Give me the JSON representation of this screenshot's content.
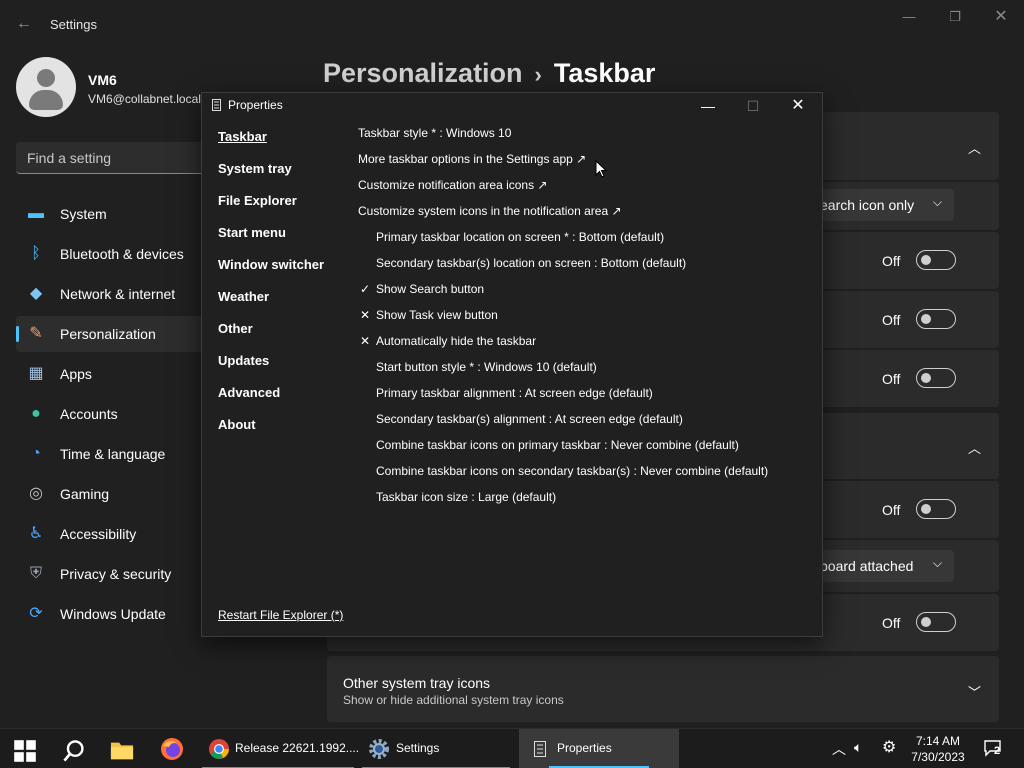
{
  "settings": {
    "window_title": "Settings",
    "profile": {
      "name": "VM6",
      "email": "VM6@collabnet.local"
    },
    "search_placeholder": "Find a setting",
    "nav": [
      {
        "label": "System",
        "icon": "system-icon"
      },
      {
        "label": "Bluetooth & devices",
        "icon": "bluetooth-icon"
      },
      {
        "label": "Network & internet",
        "icon": "network-icon"
      },
      {
        "label": "Personalization",
        "icon": "brush-icon",
        "active": true
      },
      {
        "label": "Apps",
        "icon": "apps-icon"
      },
      {
        "label": "Accounts",
        "icon": "accounts-icon"
      },
      {
        "label": "Time & language",
        "icon": "clock-globe-icon"
      },
      {
        "label": "Gaming",
        "icon": "gamepad-icon"
      },
      {
        "label": "Accessibility",
        "icon": "accessibility-icon"
      },
      {
        "label": "Privacy & security",
        "icon": "shield-icon"
      },
      {
        "label": "Windows Update",
        "icon": "update-icon"
      }
    ],
    "breadcrumb": {
      "parent": "Personalization",
      "separator": "›",
      "current": "Taskbar"
    },
    "search_dropdown_value": "earch icon only",
    "keyboard_dropdown_value": "board attached",
    "toggle_state": "Off",
    "other_tray": {
      "title": "Other system tray icons",
      "subtitle": "Show or hide additional system tray icons"
    }
  },
  "dialog": {
    "title": "Properties",
    "nav": [
      "Taskbar",
      "System tray",
      "File Explorer",
      "Start menu",
      "Window switcher",
      "Weather",
      "Other",
      "Updates",
      "Advanced",
      "About"
    ],
    "options": [
      {
        "mark": "",
        "text": "Taskbar style * : Windows 10",
        "indent": false
      },
      {
        "mark": "",
        "text": "More taskbar options in the Settings app ↗",
        "indent": false
      },
      {
        "mark": "",
        "text": "Customize notification area icons ↗",
        "indent": false
      },
      {
        "mark": "",
        "text": "Customize system icons in the notification area ↗",
        "indent": false
      },
      {
        "mark": "",
        "text": "Primary taskbar location on screen * : Bottom (default)",
        "indent": true
      },
      {
        "mark": "",
        "text": "Secondary taskbar(s) location on screen : Bottom (default)",
        "indent": true
      },
      {
        "mark": "✓",
        "text": "Show Search button",
        "indent": true
      },
      {
        "mark": "✕",
        "text": "Show Task view button",
        "indent": true
      },
      {
        "mark": "✕",
        "text": "Automatically hide the taskbar",
        "indent": true
      },
      {
        "mark": "",
        "text": "Start button style * : Windows 10 (default)",
        "indent": true
      },
      {
        "mark": "",
        "text": "Primary taskbar alignment : At screen edge (default)",
        "indent": true
      },
      {
        "mark": "",
        "text": "Secondary taskbar(s) alignment : At screen edge (default)",
        "indent": true
      },
      {
        "mark": "",
        "text": "Combine taskbar icons on primary taskbar : Never combine (default)",
        "indent": true
      },
      {
        "mark": "",
        "text": "Combine taskbar icons on secondary taskbar(s) : Never combine (default)",
        "indent": true
      },
      {
        "mark": "",
        "text": "Taskbar icon size : Large (default)",
        "indent": true
      }
    ],
    "restart_link": "Restart File Explorer (*)"
  },
  "taskbar": {
    "apps": [
      {
        "label": "Release 22621.1992....",
        "icon": "chrome-icon"
      },
      {
        "label": "Settings",
        "icon": "gear-icon"
      },
      {
        "label": "Properties",
        "icon": "properties-icon"
      }
    ],
    "time": "7:14 AM",
    "date": "7/30/2023",
    "notification_count": "2"
  },
  "colors": {
    "accent": "#4cc2ff",
    "background": "#202020",
    "card": "#2b2b2b"
  }
}
